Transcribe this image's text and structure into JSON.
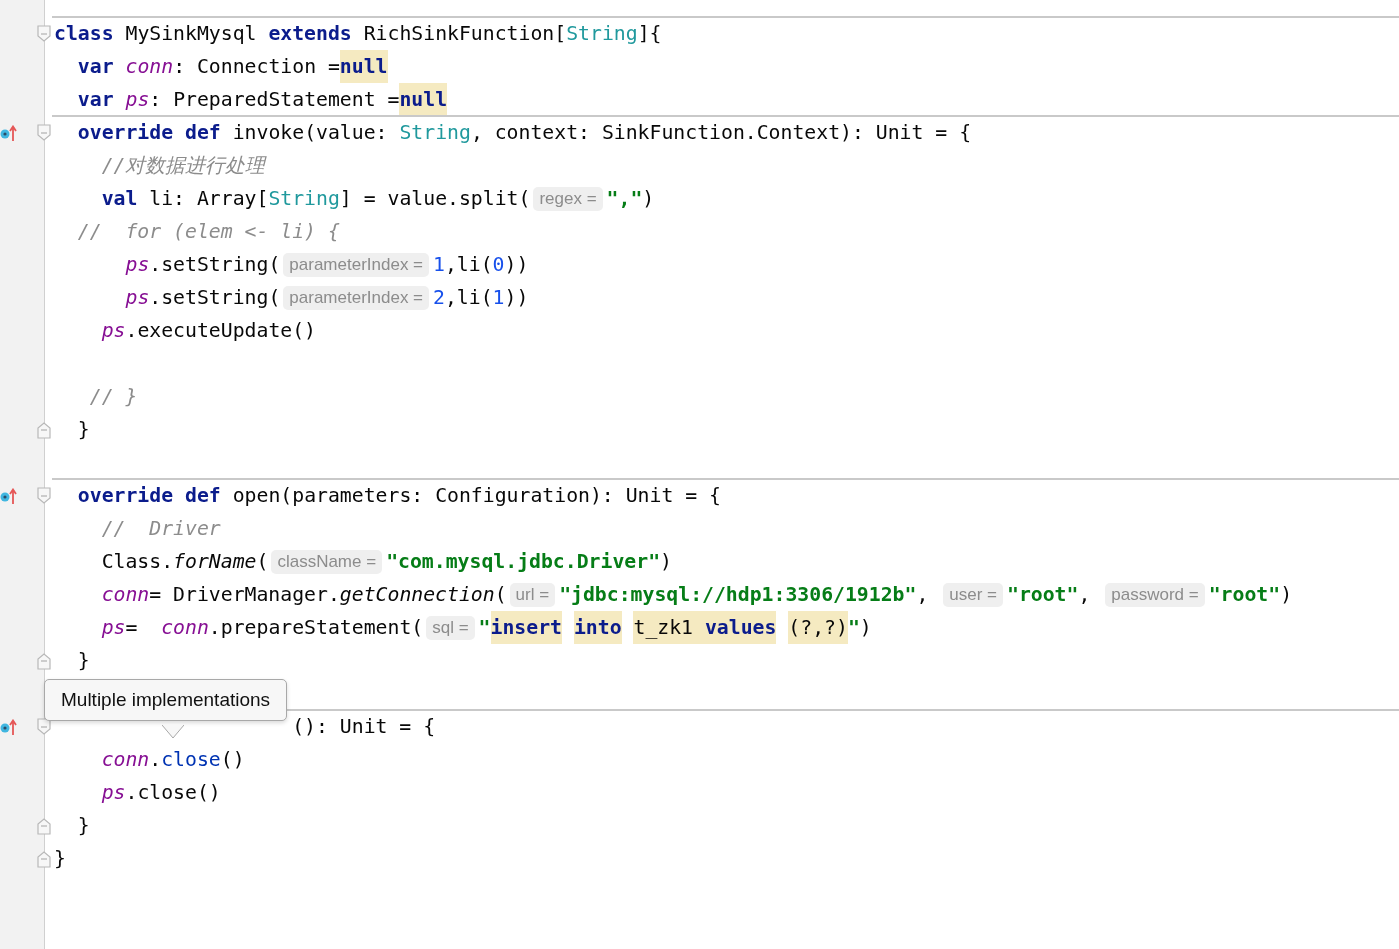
{
  "lines": [
    {
      "separator_above": true,
      "override_marker": false,
      "fold_start": true,
      "fold_end": false,
      "tokens": [
        {
          "kind": "kw",
          "text": "class"
        },
        {
          "kind": "plain",
          "text": " MySinkMysql "
        },
        {
          "kind": "kw",
          "text": "extends"
        },
        {
          "kind": "plain",
          "text": " RichSinkFunction["
        },
        {
          "kind": "type",
          "text": "String"
        },
        {
          "kind": "plain",
          "text": "]{"
        }
      ]
    },
    {
      "separator_above": false,
      "override_marker": false,
      "fold_start": false,
      "fold_end": false,
      "tokens": [
        {
          "kind": "kw",
          "text": "  var"
        },
        {
          "kind": "field",
          "text": " conn"
        },
        {
          "kind": "plain",
          "text": ": Connection ="
        },
        {
          "kind": "kw",
          "text": "null",
          "highlighted": true
        }
      ]
    },
    {
      "separator_above": false,
      "override_marker": false,
      "fold_start": false,
      "fold_end": false,
      "tokens": [
        {
          "kind": "kw",
          "text": "  var"
        },
        {
          "kind": "field",
          "text": " ps"
        },
        {
          "kind": "plain",
          "text": ": PreparedStatement ="
        },
        {
          "kind": "kw",
          "text": "null",
          "highlighted": true
        }
      ]
    },
    {
      "separator_above": true,
      "override_marker": true,
      "fold_start": true,
      "fold_end": false,
      "tokens": [
        {
          "kind": "kw",
          "text": "  override def"
        },
        {
          "kind": "plain",
          "text": " invoke(value: "
        },
        {
          "kind": "type",
          "text": "String"
        },
        {
          "kind": "plain",
          "text": ", context: SinkFunction.Context): Unit = {"
        }
      ]
    },
    {
      "separator_above": false,
      "override_marker": false,
      "fold_start": false,
      "fold_end": false,
      "tokens": [
        {
          "kind": "comment",
          "text": "    //对数据进行处理"
        }
      ]
    },
    {
      "separator_above": false,
      "override_marker": false,
      "fold_start": false,
      "fold_end": false,
      "tokens": [
        {
          "kind": "kw",
          "text": "    val"
        },
        {
          "kind": "plain",
          "text": " li: Array["
        },
        {
          "kind": "type",
          "text": "String"
        },
        {
          "kind": "plain",
          "text": "] = value.split("
        },
        {
          "kind": "hint",
          "text": "regex ="
        },
        {
          "kind": "str",
          "text": "\",\""
        },
        {
          "kind": "plain",
          "text": ")"
        }
      ]
    },
    {
      "separator_above": false,
      "override_marker": false,
      "fold_start": false,
      "fold_end": false,
      "tokens": [
        {
          "kind": "comment",
          "text": "  //  for (elem <- li) {"
        }
      ]
    },
    {
      "separator_above": false,
      "override_marker": false,
      "fold_start": false,
      "fold_end": false,
      "tokens": [
        {
          "kind": "field",
          "text": "      ps"
        },
        {
          "kind": "plain",
          "text": ".setString("
        },
        {
          "kind": "hint",
          "text": "parameterIndex ="
        },
        {
          "kind": "num",
          "text": "1"
        },
        {
          "kind": "plain",
          "text": ",li("
        },
        {
          "kind": "num",
          "text": "0"
        },
        {
          "kind": "plain",
          "text": "))"
        }
      ]
    },
    {
      "separator_above": false,
      "override_marker": false,
      "fold_start": false,
      "fold_end": false,
      "tokens": [
        {
          "kind": "field",
          "text": "      ps"
        },
        {
          "kind": "plain",
          "text": ".setString("
        },
        {
          "kind": "hint",
          "text": "parameterIndex ="
        },
        {
          "kind": "num",
          "text": "2"
        },
        {
          "kind": "plain",
          "text": ",li("
        },
        {
          "kind": "num",
          "text": "1"
        },
        {
          "kind": "plain",
          "text": "))"
        }
      ]
    },
    {
      "separator_above": false,
      "override_marker": false,
      "fold_start": false,
      "fold_end": false,
      "tokens": [
        {
          "kind": "field",
          "text": "    ps"
        },
        {
          "kind": "plain",
          "text": ".executeUpdate()"
        }
      ]
    },
    {
      "separator_above": false,
      "override_marker": false,
      "fold_start": false,
      "fold_end": false
    },
    {
      "separator_above": false,
      "override_marker": false,
      "fold_start": false,
      "fold_end": false,
      "tokens": [
        {
          "kind": "comment",
          "text": "   // }"
        }
      ]
    },
    {
      "separator_above": false,
      "override_marker": false,
      "fold_start": false,
      "fold_end": true,
      "tokens": [
        {
          "kind": "plain",
          "text": "  }"
        }
      ]
    },
    {
      "separator_above": false,
      "override_marker": false,
      "fold_start": false,
      "fold_end": false
    },
    {
      "separator_above": true,
      "override_marker": true,
      "fold_start": true,
      "fold_end": false,
      "tokens": [
        {
          "kind": "kw",
          "text": "  override def"
        },
        {
          "kind": "plain",
          "text": " open(parameters: Configuration): Unit = {"
        }
      ]
    },
    {
      "separator_above": false,
      "override_marker": false,
      "fold_start": false,
      "fold_end": false,
      "tokens": [
        {
          "kind": "comment",
          "text": "    //  Driver"
        }
      ]
    },
    {
      "separator_above": false,
      "override_marker": false,
      "fold_start": false,
      "fold_end": false,
      "tokens": [
        {
          "kind": "plain",
          "text": "    Class."
        },
        {
          "kind": "italic",
          "text": "forName"
        },
        {
          "kind": "plain",
          "text": "("
        },
        {
          "kind": "hint",
          "text": "className ="
        },
        {
          "kind": "str",
          "text": "\"com.mysql.jdbc.Driver\""
        },
        {
          "kind": "plain",
          "text": ")"
        }
      ]
    },
    {
      "separator_above": false,
      "override_marker": false,
      "fold_start": false,
      "fold_end": false,
      "tokens": [
        {
          "kind": "field",
          "text": "    conn"
        },
        {
          "kind": "plain",
          "text": "= DriverManager."
        },
        {
          "kind": "italic",
          "text": "getConnection"
        },
        {
          "kind": "plain",
          "text": "("
        },
        {
          "kind": "hint",
          "text": "url ="
        },
        {
          "kind": "str",
          "text": "\"jdbc:mysql://hdp1:3306/1912b\""
        },
        {
          "kind": "plain",
          "text": ", "
        },
        {
          "kind": "hint",
          "text": "user ="
        },
        {
          "kind": "str",
          "text": "\"root\""
        },
        {
          "kind": "plain",
          "text": ", "
        },
        {
          "kind": "hint",
          "text": "password ="
        },
        {
          "kind": "str",
          "text": "\"root\""
        },
        {
          "kind": "plain",
          "text": ")"
        }
      ]
    },
    {
      "separator_above": false,
      "override_marker": false,
      "fold_start": false,
      "fold_end": false,
      "tokens": [
        {
          "kind": "field",
          "text": "    ps"
        },
        {
          "kind": "plain",
          "text": "=  "
        },
        {
          "kind": "field",
          "text": "conn"
        },
        {
          "kind": "plain",
          "text": ".prepareStatement("
        },
        {
          "kind": "hint",
          "text": "sql ="
        },
        {
          "kind": "str",
          "text": "\""
        },
        {
          "kind": "kw",
          "text": "insert",
          "highlighted": true
        },
        {
          "kind": "kw",
          "text": " into",
          "highlighted": true
        },
        {
          "kind": "plain",
          "text": " t_zk1 ",
          "highlighted": true
        },
        {
          "kind": "kw",
          "text": "values",
          "highlighted": true
        },
        {
          "kind": "plain",
          "text": " (?,?)",
          "highlighted": true
        },
        {
          "kind": "str",
          "text": "\""
        },
        {
          "kind": "plain",
          "text": ")"
        }
      ]
    },
    {
      "separator_above": false,
      "override_marker": false,
      "fold_start": false,
      "fold_end": true,
      "tokens": [
        {
          "kind": "plain",
          "text": "  }"
        }
      ]
    },
    {
      "separator_above": false,
      "override_marker": false,
      "fold_start": false,
      "fold_end": false
    },
    {
      "separator_above": true,
      "override_marker": true,
      "fold_start": true,
      "fold_end": false,
      "tokens": [
        {
          "kind": "plain",
          "text": "                    (): Unit = {"
        }
      ]
    },
    {
      "separator_above": false,
      "override_marker": false,
      "fold_start": false,
      "fold_end": false,
      "tokens": [
        {
          "kind": "field",
          "text": "    conn"
        },
        {
          "kind": "plain",
          "text": "."
        },
        {
          "kind": "call",
          "text": "close"
        },
        {
          "kind": "plain",
          "text": "()"
        }
      ]
    },
    {
      "separator_above": false,
      "override_marker": false,
      "fold_start": false,
      "fold_end": false,
      "tokens": [
        {
          "kind": "field",
          "text": "    ps"
        },
        {
          "kind": "plain",
          "text": ".close()"
        }
      ]
    },
    {
      "separator_above": false,
      "override_marker": false,
      "fold_start": false,
      "fold_end": true,
      "tokens": [
        {
          "kind": "plain",
          "text": "  }"
        }
      ]
    },
    {
      "separator_above": false,
      "override_marker": false,
      "fold_start": false,
      "fold_end": true,
      "tokens": [
        {
          "kind": "plain",
          "text": "}"
        }
      ]
    }
  ],
  "tooltip": {
    "text": "Multiple implementations"
  }
}
